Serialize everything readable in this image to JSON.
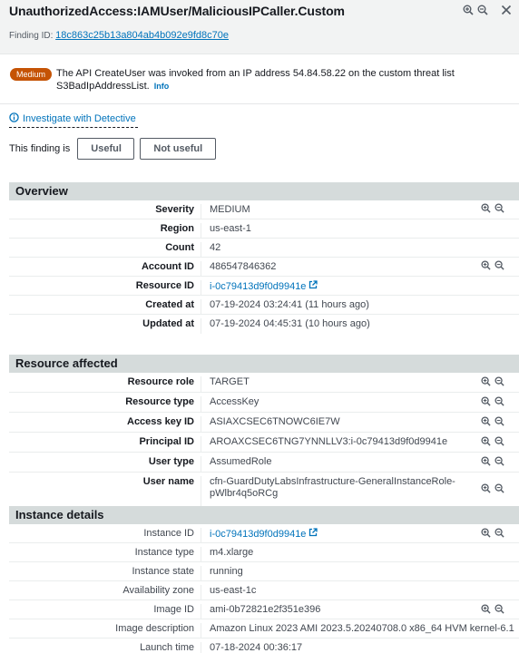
{
  "title": "UnauthorizedAccess:IAMUser/MaliciousIPCaller.Custom",
  "finding_id_label": "Finding ID:",
  "finding_id": "18c863c25b13a804ab4b092e9fd8c70e",
  "severity_badge": "Medium",
  "banner_text": "The API CreateUser was invoked from an IP address 54.84.58.22 on the custom threat list S3BadIpAddressList.",
  "info_link": "Info",
  "detective_link": "Investigate with Detective",
  "useful_prompt": "This finding is",
  "useful_btn": "Useful",
  "not_useful_btn": "Not useful",
  "overview": {
    "title": "Overview",
    "rows": [
      {
        "label": "Severity",
        "value": "MEDIUM"
      },
      {
        "label": "Region",
        "value": "us-east-1"
      },
      {
        "label": "Count",
        "value": "42"
      },
      {
        "label": "Account ID",
        "value": "486547846362"
      },
      {
        "label": "Resource ID",
        "value": "i-0c79413d9f0d9941e"
      },
      {
        "label": "Created at",
        "value": "07-19-2024 03:24:41 (11 hours ago)"
      },
      {
        "label": "Updated at",
        "value": "07-19-2024 04:45:31 (10 hours ago)"
      }
    ]
  },
  "resource": {
    "title": "Resource affected",
    "rows": [
      {
        "label": "Resource role",
        "value": "TARGET"
      },
      {
        "label": "Resource type",
        "value": "AccessKey"
      },
      {
        "label": "Access key ID",
        "value": "ASIAXCSEC6TNOWC6IE7W"
      },
      {
        "label": "Principal ID",
        "value": "AROAXCSEC6TNG7YNNLLV3:i-0c79413d9f0d9941e"
      },
      {
        "label": "User type",
        "value": "AssumedRole"
      },
      {
        "label": "User name",
        "value": "cfn-GuardDutyLabsInfrastructure-GeneralInstanceRole-pWlbr4q5oRCg"
      }
    ]
  },
  "instance": {
    "title": "Instance details",
    "rows": [
      {
        "label": "Instance ID",
        "value": "i-0c79413d9f0d9941e"
      },
      {
        "label": "Instance type",
        "value": "m4.xlarge"
      },
      {
        "label": "Instance state",
        "value": "running"
      },
      {
        "label": "Availability zone",
        "value": "us-east-1c"
      },
      {
        "label": "Image ID",
        "value": "ami-0b72821e2f351e396"
      },
      {
        "label": "Image description",
        "value": "Amazon Linux 2023 AMI 2023.5.20240708.0 x86_64 HVM kernel-6.1"
      },
      {
        "label": "Launch time",
        "value": "07-18-2024 00:36:17"
      }
    ]
  },
  "colors": {
    "link": "#0073bb",
    "badge": "#c55305",
    "section_bg": "#d5dbdb"
  }
}
